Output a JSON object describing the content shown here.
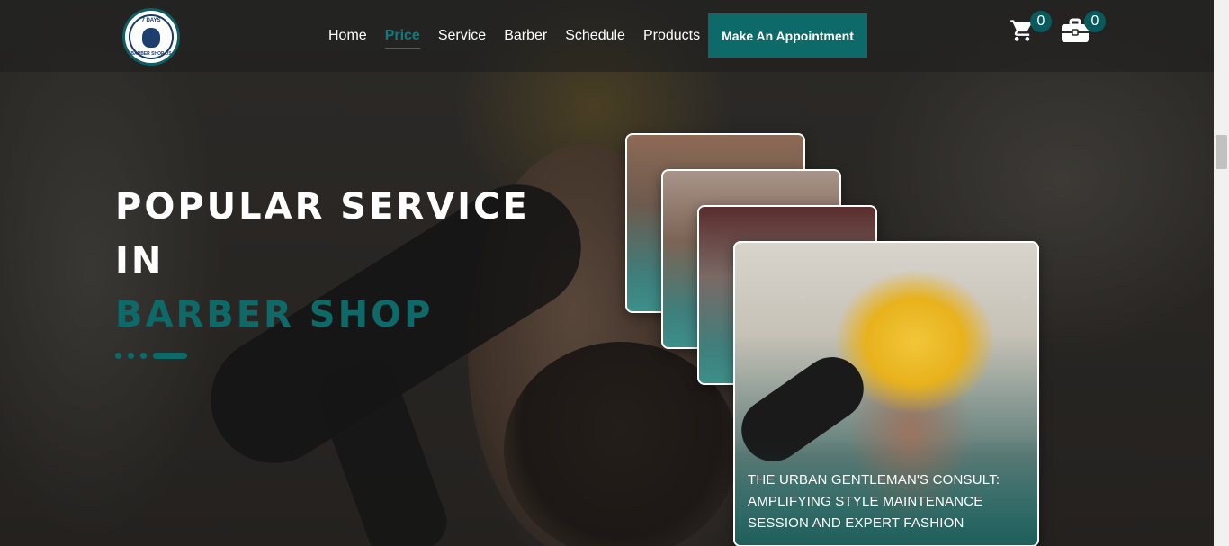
{
  "brand": {
    "logo_top": "7 DAYS",
    "logo_bottom": "BARBER SHOP US"
  },
  "nav": {
    "items": [
      "Home",
      "Price",
      "Service",
      "Barber",
      "Schedule",
      "Products"
    ],
    "active": "Price",
    "cta": "Make An Appointment"
  },
  "header_icons": {
    "cart_icon": "cart-icon",
    "cart_count": "0",
    "bag_icon": "briefcase-icon",
    "bag_count": "0"
  },
  "hero": {
    "line1": "POPULAR SERVICE",
    "line2": "IN",
    "line3": "BARBER SHOP"
  },
  "cards": {
    "featured_caption": "THE URBAN GENTLEMAN'S CONSULT: AMPLIFYING STYLE MAINTENANCE SESSION AND EXPERT FASHION"
  },
  "colors": {
    "accent": "#0e6a69",
    "accent_text": "#0f7a7e"
  }
}
